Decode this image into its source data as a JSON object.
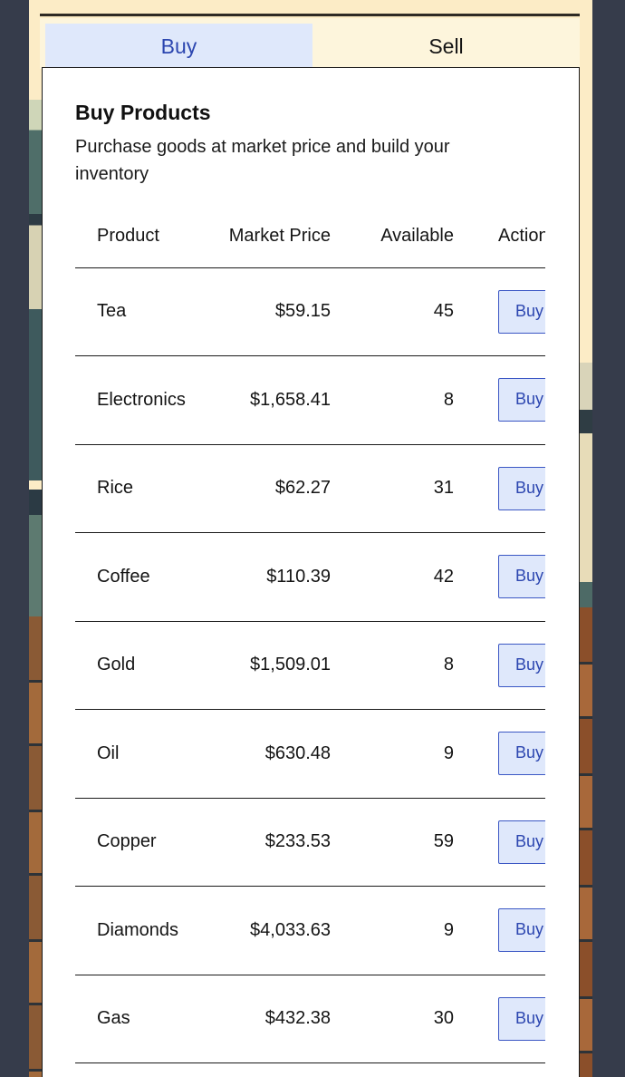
{
  "tabs": [
    {
      "label": "Buy",
      "active": true
    },
    {
      "label": "Sell",
      "active": false
    }
  ],
  "panel": {
    "title": "Buy Products",
    "description": "Purchase goods at market price and build your inventory"
  },
  "table": {
    "headers": {
      "product": "Product",
      "price": "Market Price",
      "available": "Available",
      "action": "Action"
    },
    "rows": [
      {
        "product": "Tea",
        "price": "$59.15",
        "available": "45",
        "action": "Buy"
      },
      {
        "product": "Electronics",
        "price": "$1,658.41",
        "available": "8",
        "action": "Buy"
      },
      {
        "product": "Rice",
        "price": "$62.27",
        "available": "31",
        "action": "Buy"
      },
      {
        "product": "Coffee",
        "price": "$110.39",
        "available": "42",
        "action": "Buy"
      },
      {
        "product": "Gold",
        "price": "$1,509.01",
        "available": "8",
        "action": "Buy"
      },
      {
        "product": "Oil",
        "price": "$630.48",
        "available": "9",
        "action": "Buy"
      },
      {
        "product": "Copper",
        "price": "$233.53",
        "available": "59",
        "action": "Buy"
      },
      {
        "product": "Diamonds",
        "price": "$4,033.63",
        "available": "9",
        "action": "Buy"
      },
      {
        "product": "Gas",
        "price": "$432.38",
        "available": "30",
        "action": "Buy"
      }
    ]
  },
  "colors": {
    "background": "#363c4b",
    "frame": "#fcecc6",
    "accent": "#2c46b0",
    "active_tab": "#dfe8fb"
  }
}
